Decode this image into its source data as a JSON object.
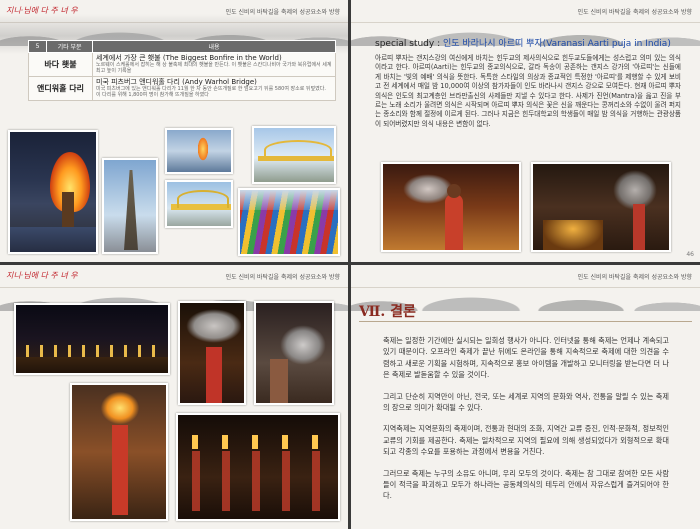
{
  "header": {
    "logo": "지니·님에 다 주 녀 우",
    "title": "인도 신비의 바탁길을 축제의 성공요소와 방향"
  },
  "page1": {
    "table": {
      "col_no": "5",
      "col_name": "기타 부문",
      "col_content": "내용",
      "rows": [
        {
          "name": "바다 횃불",
          "main": "세계에서 가장 큰 횃불 (The Biggest Bonfire in the World)",
          "sub": "노르웨이 스케롤에서 잡히는 해 상 불축제 최대의 횃불을 만든다. 이 횃불은 스칸디나비아 국가와 북유럽에서 세계 최고 높이 기록을"
        },
        {
          "name": "앤디워홀 다리",
          "main": "미국 피츠버그 앤디워홀 다리 (Andy Warhol Bridge)",
          "sub": "미국 피츠버그에 있는 앤디워홀 다리가 11월 한 차 동안 손뜨개질로 한 덮요고기 뒤를 580여 장소로 뒤덮였다. 이 다리를 위해 1,800여 명이 참가해 뜨개질을 하였다"
        }
      ]
    }
  },
  "page2": {
    "title_prefix": "special study : ",
    "title_main": "인도 바라나시 아르띠 뿌자(Varanasi Aarti puja in India)",
    "body": "아르띠 뿌자는 갠지스강의 여신에게 바치는 힌두교의 제사의식으로 힌두교도들에게는 성스럽고 의미 있는 의식이라고 한다. 아르띠(Aarti)는 힌두교의 종교의식으로, 갈라 독송이 공존하는 갠지스 강가의 '아르띠'는 신들에게 바치는 '빛의 예배' 의식을 뜻한다. 독특한 스타일의 의상과 종교적인 특정한 '아르띠'를 제행할 수 있게 보비고 전 세계에서 매일 밤 10,000여 이상의 참가자들이 인도 바라나시 갠지스 강으로 모여든다. 현재 아르띠 뿌자 의식은 인도의 최고계층인 브라만출신의 사제들만 지낼 수 있다고 한다. 사제가 진언(Mantra)을 읊고 진을 부르는 노래 소리가 울려면 의식은 시작되며 아르띠 뿌자 의식은 꽃은 신을 깨운다는 콩꺼리소와 수없이 울려 퍼지는 종소리와 함께 절정에 이르게 된다. 그러나 지금은 힌두대학교의 학생들이 매일 밤 의식을 거행하는 관광상품이 되어버렸지만 의식 내용은 변함이 없다.",
    "page_number": "46"
  },
  "page4": {
    "heading": "Ⅶ. 결론",
    "paragraphs": [
      "축제는 일정한 기간에만 실시되는 일회성 행사가 아니다. 인터넷을 통해 축제는 언제나 계속되고 있기 때문이다. 오프라인 축제가 끝난 뒤에도 온라인을 통해 지속적으로 축제에 대한 의견을 수렴하고 새로운 기획을 시험하며, 지속적으로 홍보 아이템을 개발하고 모니터링을 받는다면 더 나은 축제로 발돋움할 수 있을 것이다.",
      "그리고 단순히 지역만이 아닌, 전국, 또는 세계로 지역의 문화와 역사, 전통을 알릴 수 있는 축제의 장으로 의미가 확대될 수 있다.",
      "지역축제는 지역문화의 축제이며, 전통과 현대의 조화, 지역간 교류 증진, 인적·문화적, 정보적인 교류의 기회를 제공한다. 축제는 일차적으로 지역의 필요에 의해 생성되었다가 외형적으로 확대되고 각종의 수요를 포용하는 과정에서 변용을 거친다.",
      "그러므로 축제는 누구의 소유도 아니며, 우리 모두의 것이다. 축제는 참 그대로 참여한 모든 사람들이 적극을 파괴하고 모두가 하나라는 공동체의식의 테두리 안에서 자유스럽게 즐겨되어야 한다."
    ]
  }
}
